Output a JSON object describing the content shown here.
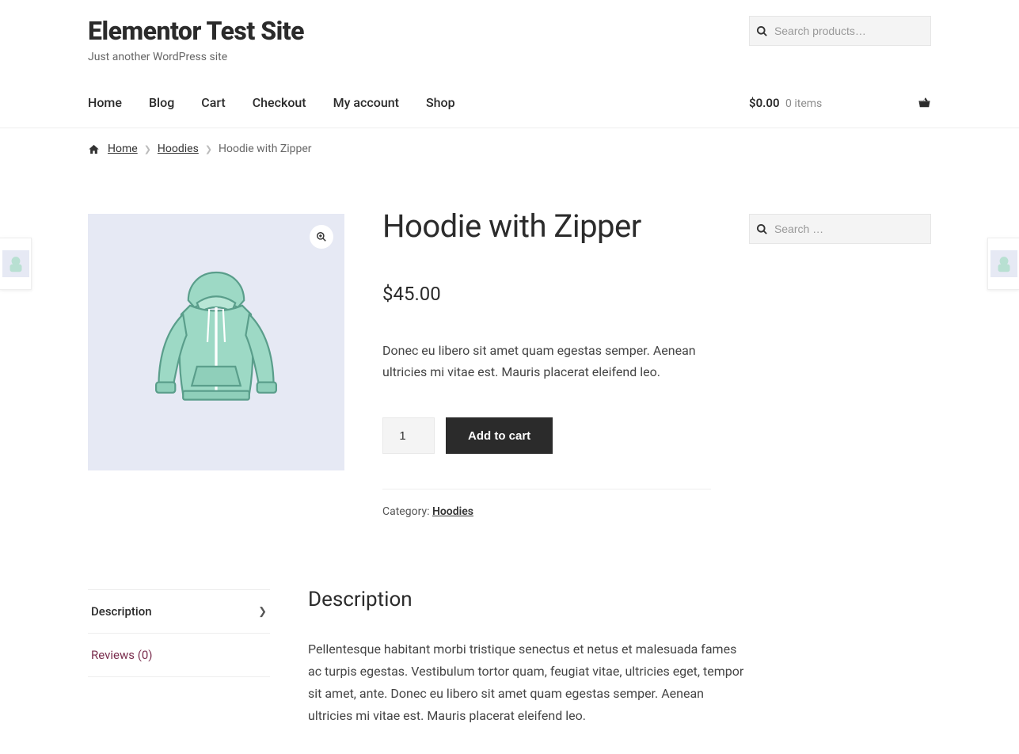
{
  "site": {
    "title": "Elementor Test Site",
    "tagline": "Just another WordPress site"
  },
  "search_products": {
    "placeholder": "Search products…",
    "value": ""
  },
  "nav": {
    "items": [
      {
        "label": "Home"
      },
      {
        "label": "Blog"
      },
      {
        "label": "Cart"
      },
      {
        "label": "Checkout"
      },
      {
        "label": "My account"
      },
      {
        "label": "Shop"
      }
    ]
  },
  "cart": {
    "amount": "$0.00",
    "count": "0 items"
  },
  "breadcrumb": {
    "home": "Home",
    "cat": "Hoodies",
    "current": "Hoodie with Zipper"
  },
  "product": {
    "title": "Hoodie with Zipper",
    "price": "$45.00",
    "short_desc": "Donec eu libero sit amet quam egestas semper. Aenean ultricies mi vitae est. Mauris placerat eleifend leo.",
    "quantity": "1",
    "add_to_cart": "Add to cart",
    "category_label": "Category: ",
    "category_link": "Hoodies"
  },
  "sidebar_search": {
    "placeholder": "Search …",
    "value": ""
  },
  "tabs": {
    "description_label": "Description",
    "reviews_label": "Reviews (0)",
    "content_heading": "Description",
    "content_body": "Pellentesque habitant morbi tristique senectus et netus et malesuada fames ac turpis egestas. Vestibulum tortor quam, feugiat vitae, ultricies eget, tempor sit amet, ante. Donec eu libero sit amet quam egestas semper. Aenean ultricies mi vitae est. Mauris placerat eleifend leo."
  }
}
